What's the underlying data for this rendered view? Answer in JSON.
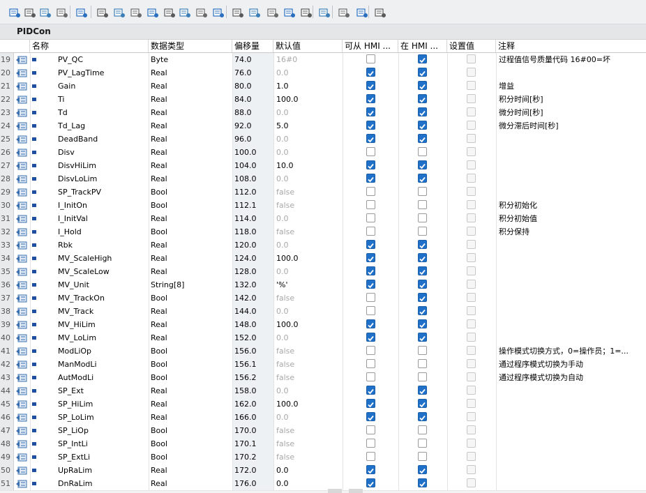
{
  "block_title": "PIDCon",
  "columns": {
    "name": "名称",
    "type": "数据类型",
    "offset": "偏移量",
    "default": "默认值",
    "hmi_access": "可从 HMI ...",
    "hmi_visible": "在 HMI ...",
    "setpoint": "设置值",
    "comment": "注释"
  },
  "toolbar_icons": [
    "insert-row-icon",
    "delete-row-icon",
    "expand-icon",
    "collapse-icon",
    "monitor-icon",
    "block-view-icon",
    "table-view-icon",
    "list-view-icon",
    "comment-icon",
    "download-icon",
    "upload-icon",
    "list-icon",
    "settings-icon",
    "snapshot-icon",
    "restore-icon",
    "copy-values-icon",
    "apply-icon",
    "indent-icon",
    "outdent-icon",
    "search-icon",
    "glasses-icon",
    "layout-icon"
  ],
  "colors": {
    "accent": "#1e70c8",
    "row_index_bg": "#e8eaec",
    "offset_bg": "#eef1f4"
  },
  "rows": [
    {
      "n": "19",
      "name": "PV_QC",
      "type": "Byte",
      "offset": "74.0",
      "default": "16#0",
      "gray": true,
      "hmi": false,
      "vis": true,
      "set": false,
      "comment": "过程值信号质量代码 16#00=坏"
    },
    {
      "n": "20",
      "name": "PV_LagTime",
      "type": "Real",
      "offset": "76.0",
      "default": "0.0",
      "gray": true,
      "hmi": true,
      "vis": true,
      "set": false,
      "comment": ""
    },
    {
      "n": "21",
      "name": "Gain",
      "type": "Real",
      "offset": "80.0",
      "default": "1.0",
      "gray": false,
      "hmi": true,
      "vis": true,
      "set": false,
      "comment": "增益"
    },
    {
      "n": "22",
      "name": "Ti",
      "type": "Real",
      "offset": "84.0",
      "default": "100.0",
      "gray": false,
      "hmi": true,
      "vis": true,
      "set": false,
      "comment": "积分时间[秒]"
    },
    {
      "n": "23",
      "name": "Td",
      "type": "Real",
      "offset": "88.0",
      "default": "0.0",
      "gray": true,
      "hmi": true,
      "vis": true,
      "set": false,
      "comment": "微分时间[秒]"
    },
    {
      "n": "24",
      "name": "Td_Lag",
      "type": "Real",
      "offset": "92.0",
      "default": "5.0",
      "gray": false,
      "hmi": true,
      "vis": true,
      "set": false,
      "comment": "微分滞后时间[秒]"
    },
    {
      "n": "25",
      "name": "DeadBand",
      "type": "Real",
      "offset": "96.0",
      "default": "0.0",
      "gray": true,
      "hmi": true,
      "vis": true,
      "set": false,
      "comment": ""
    },
    {
      "n": "26",
      "name": "Disv",
      "type": "Real",
      "offset": "100.0",
      "default": "0.0",
      "gray": true,
      "hmi": false,
      "vis": false,
      "set": false,
      "comment": ""
    },
    {
      "n": "27",
      "name": "DisvHiLim",
      "type": "Real",
      "offset": "104.0",
      "default": "10.0",
      "gray": false,
      "hmi": true,
      "vis": true,
      "set": false,
      "comment": ""
    },
    {
      "n": "28",
      "name": "DisvLoLim",
      "type": "Real",
      "offset": "108.0",
      "default": "0.0",
      "gray": true,
      "hmi": true,
      "vis": true,
      "set": false,
      "comment": ""
    },
    {
      "n": "29",
      "name": "SP_TrackPV",
      "type": "Bool",
      "offset": "112.0",
      "default": "false",
      "gray": true,
      "hmi": false,
      "vis": false,
      "set": false,
      "comment": ""
    },
    {
      "n": "30",
      "name": "I_InitOn",
      "type": "Bool",
      "offset": "112.1",
      "default": "false",
      "gray": true,
      "hmi": false,
      "vis": false,
      "set": false,
      "comment": "积分初始化"
    },
    {
      "n": "31",
      "name": "I_InitVal",
      "type": "Real",
      "offset": "114.0",
      "default": "0.0",
      "gray": true,
      "hmi": false,
      "vis": false,
      "set": false,
      "comment": "积分初始值"
    },
    {
      "n": "32",
      "name": "I_Hold",
      "type": "Bool",
      "offset": "118.0",
      "default": "false",
      "gray": true,
      "hmi": false,
      "vis": false,
      "set": false,
      "comment": "积分保持"
    },
    {
      "n": "33",
      "name": "Rbk",
      "type": "Real",
      "offset": "120.0",
      "default": "0.0",
      "gray": true,
      "hmi": true,
      "vis": true,
      "set": false,
      "comment": ""
    },
    {
      "n": "34",
      "name": "MV_ScaleHigh",
      "type": "Real",
      "offset": "124.0",
      "default": "100.0",
      "gray": false,
      "hmi": true,
      "vis": true,
      "set": false,
      "comment": ""
    },
    {
      "n": "35",
      "name": "MV_ScaleLow",
      "type": "Real",
      "offset": "128.0",
      "default": "0.0",
      "gray": true,
      "hmi": true,
      "vis": true,
      "set": false,
      "comment": ""
    },
    {
      "n": "36",
      "name": "MV_Unit",
      "type": "String[8]",
      "offset": "132.0",
      "default": "'%'",
      "gray": false,
      "hmi": true,
      "vis": true,
      "set": false,
      "comment": ""
    },
    {
      "n": "37",
      "name": "MV_TrackOn",
      "type": "Bool",
      "offset": "142.0",
      "default": "false",
      "gray": true,
      "hmi": false,
      "vis": true,
      "set": false,
      "comment": ""
    },
    {
      "n": "38",
      "name": "MV_Track",
      "type": "Real",
      "offset": "144.0",
      "default": "0.0",
      "gray": true,
      "hmi": false,
      "vis": true,
      "set": false,
      "comment": ""
    },
    {
      "n": "39",
      "name": "MV_HiLim",
      "type": "Real",
      "offset": "148.0",
      "default": "100.0",
      "gray": false,
      "hmi": true,
      "vis": true,
      "set": false,
      "comment": ""
    },
    {
      "n": "40",
      "name": "MV_LoLim",
      "type": "Real",
      "offset": "152.0",
      "default": "0.0",
      "gray": true,
      "hmi": true,
      "vis": true,
      "set": false,
      "comment": ""
    },
    {
      "n": "41",
      "name": "ModLiOp",
      "type": "Bool",
      "offset": "156.0",
      "default": "false",
      "gray": true,
      "hmi": false,
      "vis": false,
      "set": false,
      "comment": "操作模式切换方式，0=操作员；1=..."
    },
    {
      "n": "42",
      "name": "ManModLi",
      "type": "Bool",
      "offset": "156.1",
      "default": "false",
      "gray": true,
      "hmi": false,
      "vis": false,
      "set": false,
      "comment": "通过程序模式切换为手动"
    },
    {
      "n": "43",
      "name": "AutModLi",
      "type": "Bool",
      "offset": "156.2",
      "default": "false",
      "gray": true,
      "hmi": false,
      "vis": false,
      "set": false,
      "comment": "通过程序模式切换为自动"
    },
    {
      "n": "44",
      "name": "SP_Ext",
      "type": "Real",
      "offset": "158.0",
      "default": "0.0",
      "gray": true,
      "hmi": true,
      "vis": true,
      "set": false,
      "comment": ""
    },
    {
      "n": "45",
      "name": "SP_HiLim",
      "type": "Real",
      "offset": "162.0",
      "default": "100.0",
      "gray": false,
      "hmi": true,
      "vis": true,
      "set": false,
      "comment": ""
    },
    {
      "n": "46",
      "name": "SP_LoLim",
      "type": "Real",
      "offset": "166.0",
      "default": "0.0",
      "gray": true,
      "hmi": true,
      "vis": true,
      "set": false,
      "comment": ""
    },
    {
      "n": "47",
      "name": "SP_LiOp",
      "type": "Bool",
      "offset": "170.0",
      "default": "false",
      "gray": true,
      "hmi": false,
      "vis": false,
      "set": false,
      "comment": ""
    },
    {
      "n": "48",
      "name": "SP_IntLi",
      "type": "Bool",
      "offset": "170.1",
      "default": "false",
      "gray": true,
      "hmi": false,
      "vis": false,
      "set": false,
      "comment": ""
    },
    {
      "n": "49",
      "name": "SP_ExtLi",
      "type": "Bool",
      "offset": "170.2",
      "default": "false",
      "gray": true,
      "hmi": false,
      "vis": false,
      "set": false,
      "comment": ""
    },
    {
      "n": "50",
      "name": "UpRaLim",
      "type": "Real",
      "offset": "172.0",
      "default": "0.0",
      "gray": false,
      "hmi": true,
      "vis": true,
      "set": false,
      "comment": ""
    },
    {
      "n": "51",
      "name": "DnRaLim",
      "type": "Real",
      "offset": "176.0",
      "default": "0.0",
      "gray": false,
      "hmi": true,
      "vis": true,
      "set": false,
      "comment": ""
    }
  ]
}
